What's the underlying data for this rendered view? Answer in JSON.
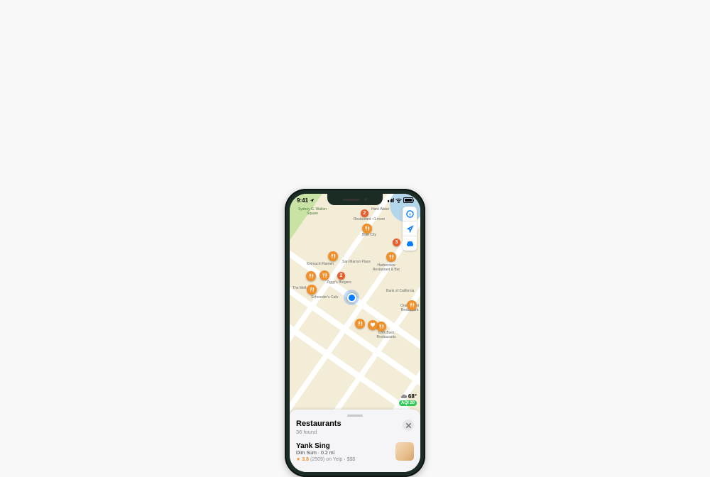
{
  "status": {
    "time": "9:41",
    "signal_label": "signal",
    "wifi_label": "wifi",
    "battery_label": "battery"
  },
  "map": {
    "park": "Sydney G. Walton Square",
    "labels": {
      "hard_water": "Hard Water",
      "restaurant_more": "Restaurant +1 more",
      "blue_city": "Blue City",
      "kirimachi": "Kirimachi Ramen",
      "ziggys": "Ziggy's Burgers",
      "melt": "The Melt",
      "schroeders": "Schroeder's Cafe",
      "san_marron": "San Marron Place",
      "harbor": "Harborview Restaurant & Bar",
      "bank_ca": "Bank of California",
      "cork_back": "Cork Back Restaurants",
      "one_market": "One Market Restaurant"
    },
    "pins": {
      "p2": "2",
      "p3": "3",
      "p2b": "2"
    }
  },
  "weather": {
    "temp": "68°",
    "aqi": "AQI 20"
  },
  "sheet": {
    "title": "Restaurants",
    "subtitle": "36 found"
  },
  "result": {
    "name": "Yank Sing",
    "cuisine": "Dim Sum",
    "distance": "0.2 mi",
    "rating": "3.8",
    "reviews": "(2509)",
    "source": "on Yelp",
    "price": "$$$"
  }
}
